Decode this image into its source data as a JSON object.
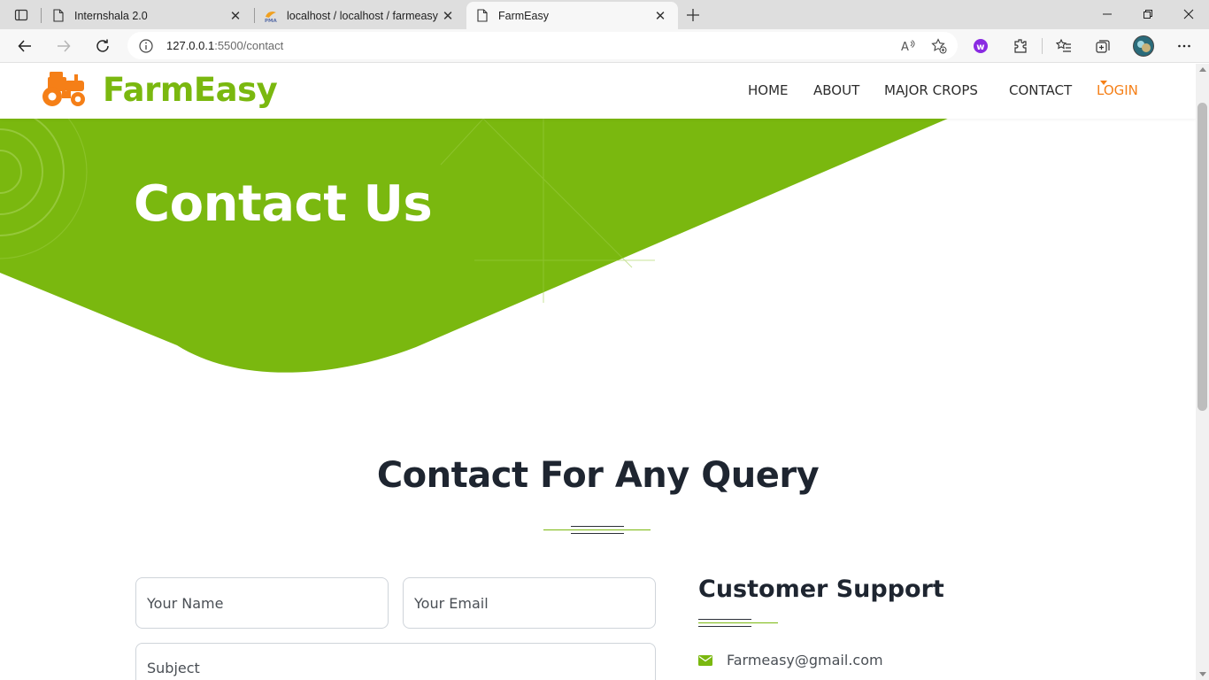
{
  "browser": {
    "tabs": [
      {
        "title": "Internshala 2.0",
        "favicon": "page-icon",
        "active": false
      },
      {
        "title": "localhost / localhost / farmeasy / ",
        "favicon": "phpmyadmin-icon",
        "active": false
      },
      {
        "title": "FarmEasy",
        "favicon": "page-icon",
        "active": true
      }
    ],
    "url_host": "127.0.0.1",
    "url_rest": ":5500/contact",
    "profile_extension_color": "#8a2be2"
  },
  "site": {
    "brand": "FarmEasy",
    "brand_color": "#7ab80f",
    "accent_color": "#f57f17",
    "nav": {
      "home": "HOME",
      "about": "ABOUT",
      "major_crops": "MAJOR CROPS",
      "contact": "CONTACT",
      "login": "LOGIN"
    }
  },
  "hero": {
    "title": "Contact Us",
    "background_color": "#7ab80f"
  },
  "contact": {
    "section_title": "Contact For Any Query",
    "form": {
      "name_placeholder": "Your Name",
      "email_placeholder": "Your Email",
      "subject_placeholder": "Subject"
    },
    "support": {
      "title": "Customer Support",
      "email": "Farmeasy@gmail.com"
    }
  }
}
